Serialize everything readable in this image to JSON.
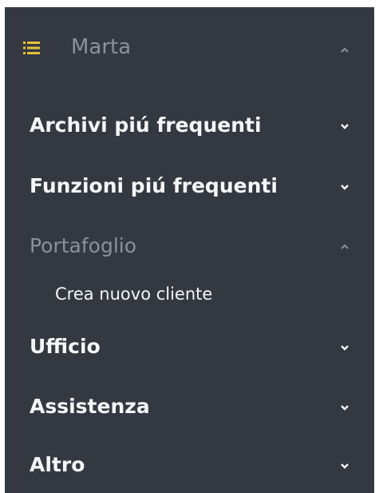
{
  "user": {
    "name": "Marta",
    "menu_icon": "list-icon",
    "expanded": true
  },
  "menu": {
    "items": [
      {
        "label": "Archivi piú frequenti",
        "expanded": false
      },
      {
        "label": "Funzioni piú frequenti",
        "expanded": false
      },
      {
        "label": "Portafoglio",
        "expanded": true,
        "children": [
          {
            "label": "Crea nuovo cliente"
          }
        ]
      },
      {
        "label": "Ufficio",
        "expanded": false
      },
      {
        "label": "Assistenza",
        "expanded": false
      },
      {
        "label": "Altro",
        "expanded": false
      }
    ]
  },
  "colors": {
    "panel_bg": "#343841",
    "text": "#f5f6f8",
    "muted_text": "#8b909a",
    "menu_icon": "#e6c13a"
  }
}
